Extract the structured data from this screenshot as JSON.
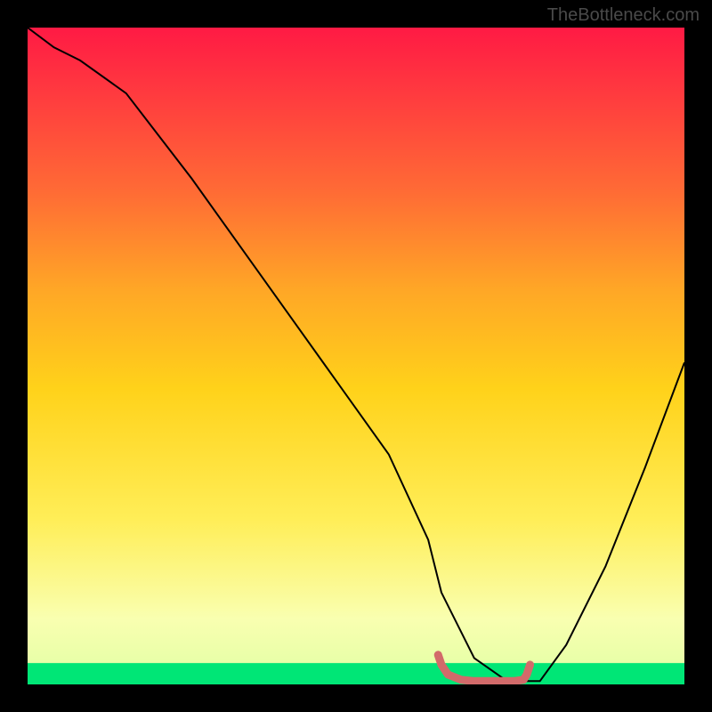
{
  "watermark": "TheBottleneck.com",
  "chart_data": {
    "type": "line",
    "title": "",
    "xlabel": "",
    "ylabel": "",
    "xlim": [
      0,
      100
    ],
    "ylim": [
      0,
      100
    ],
    "grid": false,
    "background_gradient": {
      "stops": [
        {
          "offset": 0.0,
          "color": "#ff1a44"
        },
        {
          "offset": 0.1,
          "color": "#ff3a3f"
        },
        {
          "offset": 0.25,
          "color": "#ff6b35"
        },
        {
          "offset": 0.4,
          "color": "#ffa726"
        },
        {
          "offset": 0.55,
          "color": "#ffd21a"
        },
        {
          "offset": 0.75,
          "color": "#ffee58"
        },
        {
          "offset": 0.9,
          "color": "#f9ffb0"
        },
        {
          "offset": 0.967,
          "color": "#e8ffa8"
        },
        {
          "offset": 0.968,
          "color": "#00e676"
        },
        {
          "offset": 1.0,
          "color": "#00e676"
        }
      ]
    },
    "series": [
      {
        "name": "bottleneck-curve",
        "x": [
          0,
          4,
          8,
          15,
          25,
          35,
          45,
          55,
          61,
          63,
          68,
          73,
          76,
          78,
          82,
          88,
          94,
          100
        ],
        "y": [
          100,
          97,
          95,
          90,
          77,
          63,
          49,
          35,
          22,
          14,
          4,
          0.5,
          0.5,
          0.5,
          6,
          18,
          33,
          49
        ],
        "color": "#000000",
        "width": 2
      },
      {
        "name": "highlight-segment",
        "x": [
          62.5,
          63.0,
          64.0,
          66.0,
          68.0,
          70.0,
          72.0,
          74.0,
          75.5,
          76.0,
          76.5
        ],
        "y": [
          4.5,
          3.0,
          1.5,
          0.7,
          0.5,
          0.5,
          0.5,
          0.5,
          0.7,
          1.5,
          3.0
        ],
        "color": "#d26a6a",
        "width": 9
      }
    ]
  }
}
